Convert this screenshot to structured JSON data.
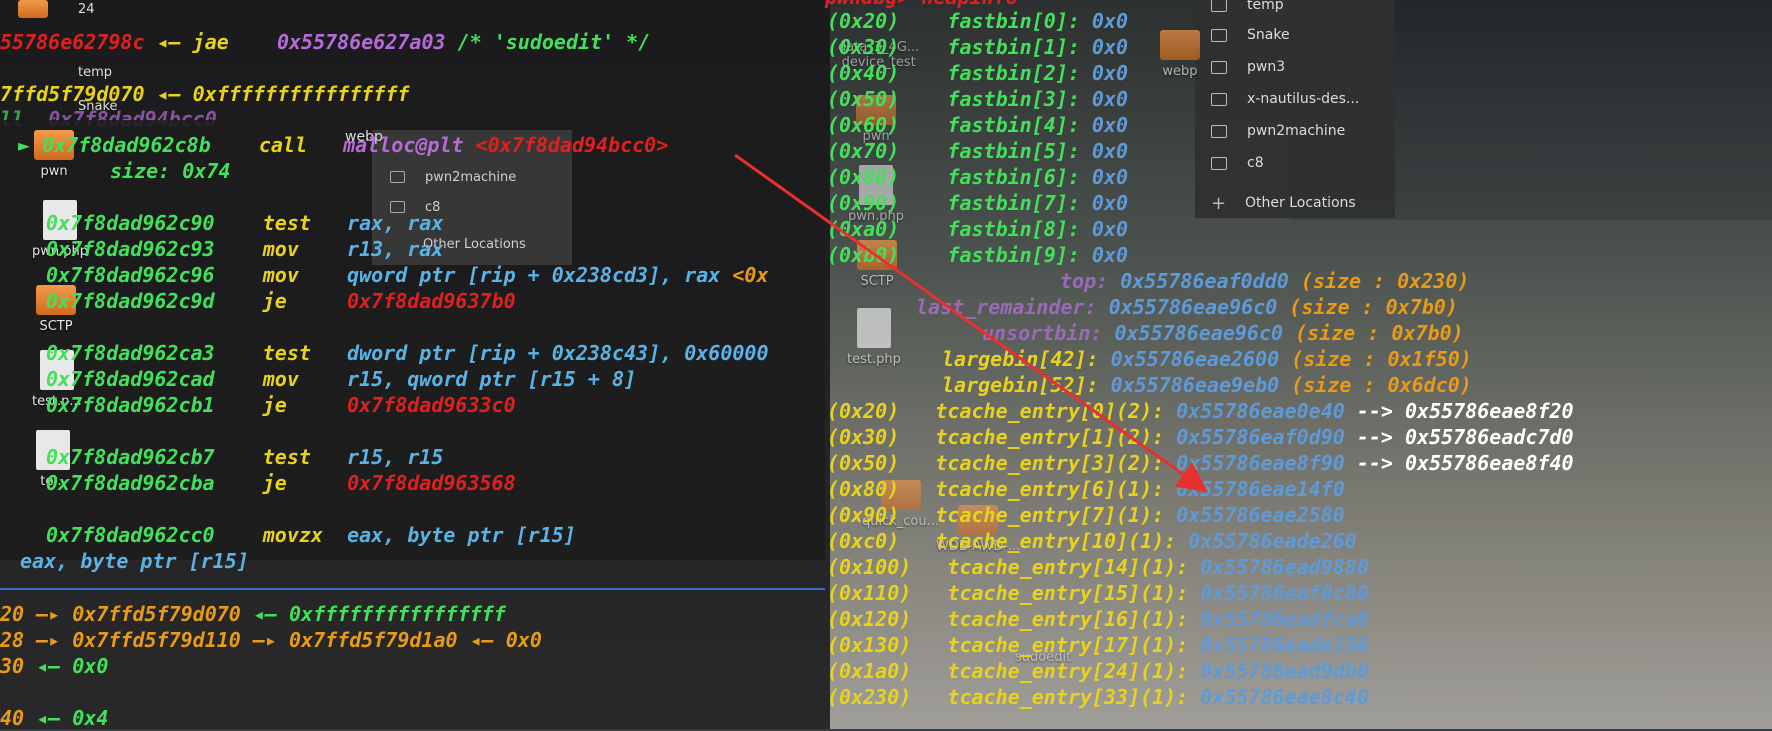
{
  "colors": {
    "address": "#43e05a",
    "red_addr": "#e02020",
    "opcode": "#e8d21c",
    "operand": "#5ab3e6",
    "symbol": "#b66bd6",
    "pointer": "#e89a18",
    "size": "#e89a18",
    "tcache_val": "#ffffff",
    "arrow": "#e83030"
  },
  "file_browser": {
    "items": [
      "temp",
      "Snake",
      "pwn3",
      "x-nautilus-des...",
      "pwn2machine",
      "c8"
    ],
    "other": "Other Locations"
  },
  "overlay_files": {
    "items": [
      "pwn2machine",
      "c8"
    ],
    "other": "Other Locations"
  },
  "desktop_icons": [
    "24",
    "temp",
    "Snake",
    "webp",
    "pwn",
    "pwn.php",
    "SCTP",
    "test.php",
    "test.p...",
    "te...",
    "quick_cou...",
    "data_3_4G...",
    "device_test",
    "webp",
    "pwn",
    "pwn.php",
    "SCTP",
    "test.php",
    "sudoedit",
    "WDB-AWD-..."
  ],
  "top_lines": [
    {
      "a": "55786e62798c",
      "b": "◂— jae",
      "c": "0x55786e627a03",
      "d": "/* 'sudoedit' */"
    },
    {
      "a": "7ffd5f79d070",
      "b": "◂— 0xffffffffffffffff"
    },
    {
      "a": "ll",
      "b": "0x7f8dad94bcc0"
    }
  ],
  "disasm": [
    {
      "arrow": "►",
      "addr": "0x7f8dad962c8b",
      "op": "call",
      "arg": "malloc@plt",
      "extra": "<0x7f8dad94bcc0>"
    },
    {
      "arrow": "",
      "addr": "",
      "op": "",
      "arg": "size: 0x74",
      "extra": ""
    },
    {
      "arrow": "",
      "addr": "0x7f8dad962c90",
      "op": "test",
      "arg": "rax, rax",
      "extra": ""
    },
    {
      "arrow": "",
      "addr": "0x7f8dad962c93",
      "op": "mov",
      "arg": "r13, rax",
      "extra": ""
    },
    {
      "arrow": "",
      "addr": "0x7f8dad962c96",
      "op": "mov",
      "arg": "qword ptr [rip + 0x238cd3], rax",
      "extra": "<0x"
    },
    {
      "arrow": "",
      "addr": "0x7f8dad962c9d",
      "op": "je",
      "arg": "0x7f8dad9637b0",
      "extra": ""
    },
    {
      "arrow": "",
      "addr": "0x7f8dad962ca3",
      "op": "test",
      "arg": "dword ptr [rip + 0x238c43], 0x60000",
      "extra": ""
    },
    {
      "arrow": "",
      "addr": "0x7f8dad962cad",
      "op": "mov",
      "arg": "r15, qword ptr [r15 + 8]",
      "extra": ""
    },
    {
      "arrow": "",
      "addr": "0x7f8dad962cb1",
      "op": "je",
      "arg": "0x7f8dad9633c0",
      "extra": ""
    },
    {
      "arrow": "",
      "addr": "0x7f8dad962cb7",
      "op": "test",
      "arg": "r15, r15",
      "extra": ""
    },
    {
      "arrow": "",
      "addr": "0x7f8dad962cba",
      "op": "je",
      "arg": "0x7f8dad963568",
      "extra": ""
    },
    {
      "arrow": "",
      "addr": "0x7f8dad962cc0",
      "op": "movzx",
      "arg": "eax, byte ptr [r15]",
      "extra": ""
    }
  ],
  "under_line": "eax, byte ptr [r15]",
  "stack": [
    {
      "a": "20 —▸",
      "b": "0x7ffd5f79d070",
      "c": "◂— 0xffffffffffffffff"
    },
    {
      "a": "28 —▸",
      "b": "0x7ffd5f79d110",
      "c": "—▸ 0x7ffd5f79d1a0 ◂— 0x0"
    },
    {
      "a": "30",
      "b": "◂— 0x0",
      "c": ""
    },
    {
      "a": "40",
      "b": "◂— 0x4",
      "c": ""
    }
  ],
  "heapinfo_title": "pwndbg> heapinfo",
  "fastbins": [
    {
      "sz": "(0x20)",
      "name": "fastbin[0]:",
      "val": "0x0"
    },
    {
      "sz": "(0x30)",
      "name": "fastbin[1]:",
      "val": "0x0"
    },
    {
      "sz": "(0x40)",
      "name": "fastbin[2]:",
      "val": "0x0"
    },
    {
      "sz": "(0x50)",
      "name": "fastbin[3]:",
      "val": "0x0"
    },
    {
      "sz": "(0x60)",
      "name": "fastbin[4]:",
      "val": "0x0"
    },
    {
      "sz": "(0x70)",
      "name": "fastbin[5]:",
      "val": "0x0"
    },
    {
      "sz": "(0x80)",
      "name": "fastbin[6]:",
      "val": "0x0"
    },
    {
      "sz": "(0x90)",
      "name": "fastbin[7]:",
      "val": "0x0"
    },
    {
      "sz": "(0xa0)",
      "name": "fastbin[8]:",
      "val": "0x0"
    },
    {
      "sz": "(0xb0)",
      "name": "fastbin[9]:",
      "val": "0x0"
    }
  ],
  "bins": [
    {
      "name": "top:",
      "val": "0x55786eaf0dd0",
      "size": "(size : 0x230)"
    },
    {
      "name": "last_remainder:",
      "val": "0x55786eae96c0",
      "size": "(size : 0x7b0)"
    },
    {
      "name": "unsortbin:",
      "val": "0x55786eae96c0",
      "size": "(size : 0x7b0)"
    },
    {
      "name": "largebin[42]:",
      "val": "0x55786eae2600",
      "size": "(size : 0x1f50)"
    },
    {
      "name": "largebin[52]:",
      "val": "0x55786eae9eb0",
      "size": "(size : 0x6dc0)"
    }
  ],
  "tcache": [
    {
      "sz": "(0x20)",
      "name": "tcache_entry[0](2):",
      "val": "0x55786eae0e40",
      "next": "--> 0x55786eae8f20"
    },
    {
      "sz": "(0x30)",
      "name": "tcache_entry[1](2):",
      "val": "0x55786eaf0d90",
      "next": "--> 0x55786eadc7d0"
    },
    {
      "sz": "(0x50)",
      "name": "tcache_entry[3](2):",
      "val": "0x55786eae8f90",
      "next": "--> 0x55786eae8f40"
    },
    {
      "sz": "(0x80)",
      "name": "tcache_entry[6](1):",
      "val": "0x55786eae14f0",
      "next": ""
    },
    {
      "sz": "(0x90)",
      "name": "tcache_entry[7](1):",
      "val": "0x55786eae2580",
      "next": ""
    },
    {
      "sz": "(0xc0)",
      "name": "tcache_entry[10](1):",
      "val": "0x55786eade260",
      "next": ""
    },
    {
      "sz": "(0x100)",
      "name": "tcache_entry[14](1):",
      "val": "0x55786ead9880",
      "next": ""
    },
    {
      "sz": "(0x110)",
      "name": "tcache_entry[15](1):",
      "val": "0x55786eaf0c80",
      "next": ""
    },
    {
      "sz": "(0x120)",
      "name": "tcache_entry[16](1):",
      "val": "0x55786eadfca0",
      "next": ""
    },
    {
      "sz": "(0x130)",
      "name": "tcache_entry[17](1):",
      "val": "0x55786eade130",
      "next": ""
    },
    {
      "sz": "(0x1a0)",
      "name": "tcache_entry[24](1):",
      "val": "0x55786ead9db0",
      "next": ""
    },
    {
      "sz": "(0x230)",
      "name": "tcache_entry[33](1):",
      "val": "0x55786eae8c40",
      "next": ""
    }
  ]
}
